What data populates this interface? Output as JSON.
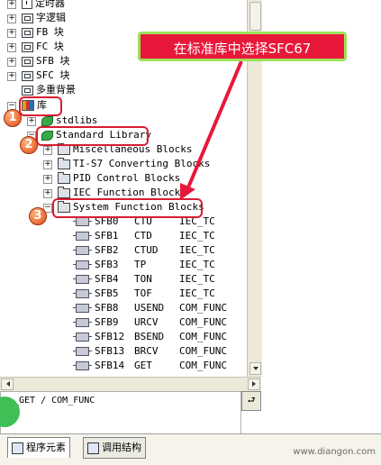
{
  "tree": {
    "top_items": [
      {
        "label": "定时器",
        "icon": "timer-icon"
      },
      {
        "label": "字逻辑",
        "icon": "logic-icon"
      },
      {
        "label": "FB 块",
        "icon": "block-icon"
      },
      {
        "label": "FC 块",
        "icon": "block-icon"
      },
      {
        "label": "SFB 块",
        "icon": "block-icon"
      },
      {
        "label": "SFC 块",
        "icon": "block-icon"
      },
      {
        "label": "多重背景",
        "icon": "block-icon"
      }
    ],
    "library_label": "库",
    "stdlibs_label": "stdlibs",
    "standard_library_label": "Standard Library",
    "sub_libraries": [
      {
        "label": "Miscellaneous Blocks"
      },
      {
        "label": "TI-S7 Converting Blocks"
      },
      {
        "label": "PID Control Blocks"
      },
      {
        "label": "IEC Function Blocks"
      },
      {
        "label": "System Function Blocks"
      }
    ],
    "sfb_items": [
      {
        "num": "SFB0",
        "name": "CTU",
        "family": "IEC_TC"
      },
      {
        "num": "SFB1",
        "name": "CTD",
        "family": "IEC_TC"
      },
      {
        "num": "SFB2",
        "name": "CTUD",
        "family": "IEC_TC"
      },
      {
        "num": "SFB3",
        "name": "TP",
        "family": "IEC_TC"
      },
      {
        "num": "SFB4",
        "name": "TON",
        "family": "IEC_TC"
      },
      {
        "num": "SFB5",
        "name": "TOF",
        "family": "IEC_TC"
      },
      {
        "num": "SFB8",
        "name": "USEND",
        "family": "COM_FUNC"
      },
      {
        "num": "SFB9",
        "name": "URCV",
        "family": "COM_FUNC"
      },
      {
        "num": "SFB12",
        "name": "BSEND",
        "family": "COM_FUNC"
      },
      {
        "num": "SFB13",
        "name": "BRCV",
        "family": "COM_FUNC"
      },
      {
        "num": "SFB14",
        "name": "GET",
        "family": "COM_FUNC"
      }
    ]
  },
  "status": {
    "text": "_GET / COM_FUNC",
    "button_label": "⮐"
  },
  "tabs": [
    {
      "label": "程序元素"
    },
    {
      "label": "调用结构"
    }
  ],
  "annotations": {
    "callout": "在标准库中选择SFC67",
    "step1": "1",
    "step2": "2",
    "step3": "3",
    "color": "#d81c32"
  },
  "watermark": "www.diangon.com"
}
